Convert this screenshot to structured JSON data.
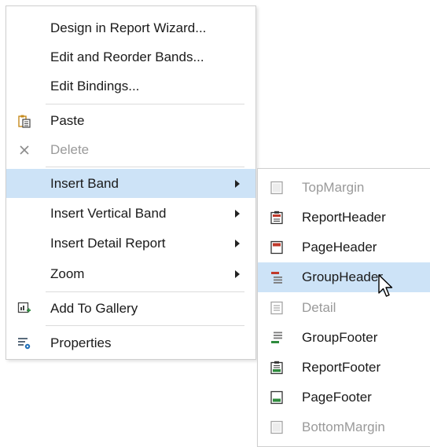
{
  "main_menu": {
    "items": [
      {
        "label": "Design in Report Wizard..."
      },
      {
        "label": "Edit and Reorder Bands..."
      },
      {
        "label": "Edit Bindings..."
      },
      {
        "label": "Paste",
        "icon": "paste-icon"
      },
      {
        "label": "Delete",
        "icon": "delete-icon",
        "disabled": true
      },
      {
        "label": "Insert Band",
        "submenu": true,
        "highlighted": true
      },
      {
        "label": "Insert Vertical Band",
        "submenu": true
      },
      {
        "label": "Insert Detail Report",
        "submenu": true
      },
      {
        "label": "Zoom",
        "submenu": true
      },
      {
        "label": "Add To Gallery",
        "icon": "add-to-gallery-icon"
      },
      {
        "label": "Properties",
        "icon": "properties-icon"
      }
    ]
  },
  "sub_menu": {
    "items": [
      {
        "label": "TopMargin",
        "icon": "top-margin-icon",
        "disabled": true
      },
      {
        "label": "ReportHeader",
        "icon": "report-header-icon"
      },
      {
        "label": "PageHeader",
        "icon": "page-header-icon"
      },
      {
        "label": "GroupHeader",
        "icon": "group-header-icon",
        "highlighted": true
      },
      {
        "label": "Detail",
        "icon": "detail-icon",
        "disabled": true
      },
      {
        "label": "GroupFooter",
        "icon": "group-footer-icon"
      },
      {
        "label": "ReportFooter",
        "icon": "report-footer-icon"
      },
      {
        "label": "PageFooter",
        "icon": "page-footer-icon"
      },
      {
        "label": "BottomMargin",
        "icon": "bottom-margin-icon",
        "disabled": true
      }
    ]
  },
  "colors": {
    "highlight": "#cde3f7",
    "band_red": "#c0392b",
    "band_green": "#2e8b3d",
    "disabled_text": "#9a9a9a"
  }
}
